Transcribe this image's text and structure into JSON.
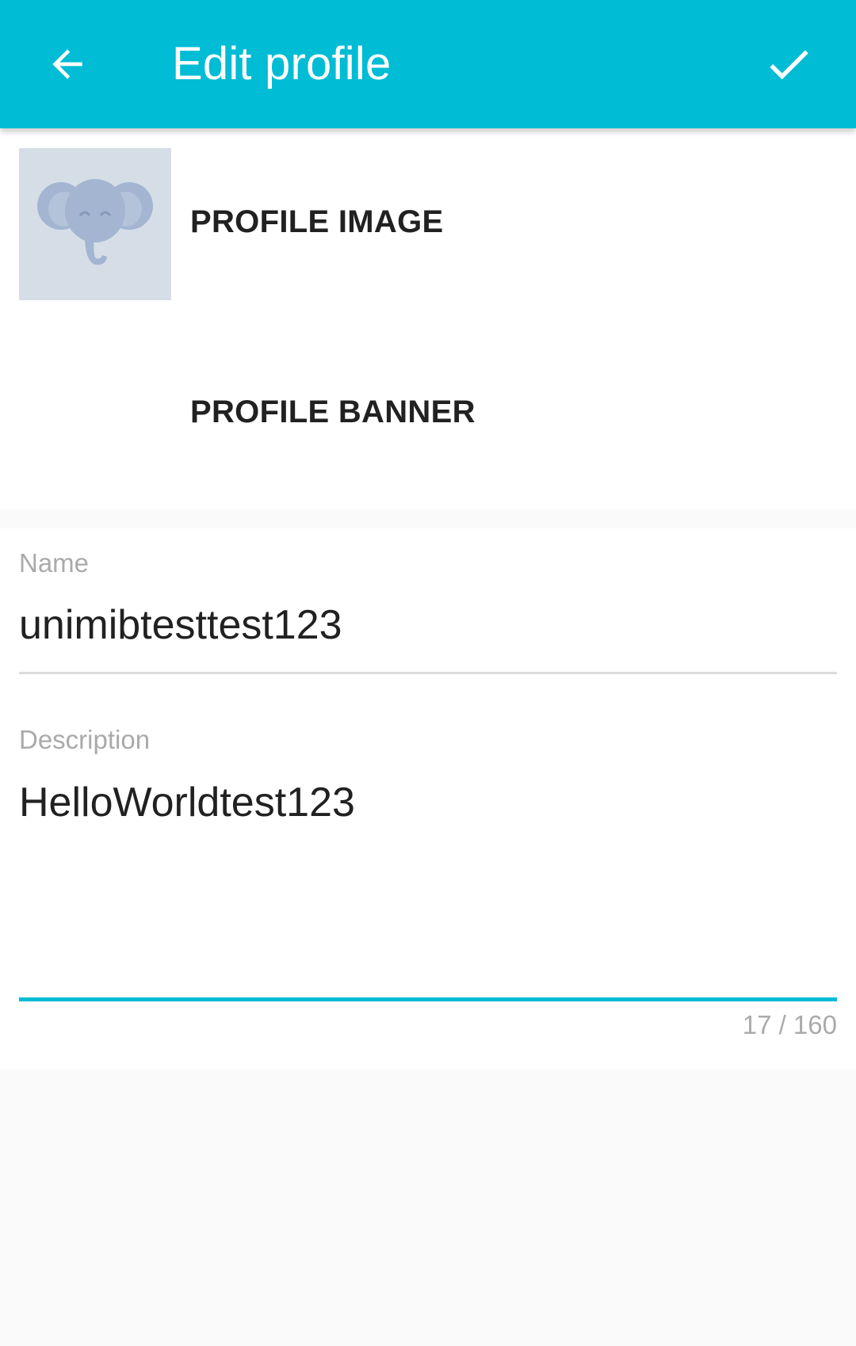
{
  "toolbar": {
    "title": "Edit profile",
    "back_icon": "arrow-back-icon",
    "confirm_icon": "check-icon",
    "color": "#00bcd4"
  },
  "images": {
    "avatar_icon": "elephant-avatar-icon",
    "profile_image_label": "PROFILE IMAGE",
    "profile_banner_label": "PROFILE BANNER"
  },
  "fields": {
    "name_label": "Name",
    "name_value": "unimibtesttest123",
    "description_label": "Description",
    "description_value": "HelloWorldtest123",
    "counter": "17 / 160"
  },
  "colors": {
    "accent": "#00bcd4",
    "avatar_bg": "#d5dde7",
    "avatar_fg": "#a3b5d1"
  }
}
